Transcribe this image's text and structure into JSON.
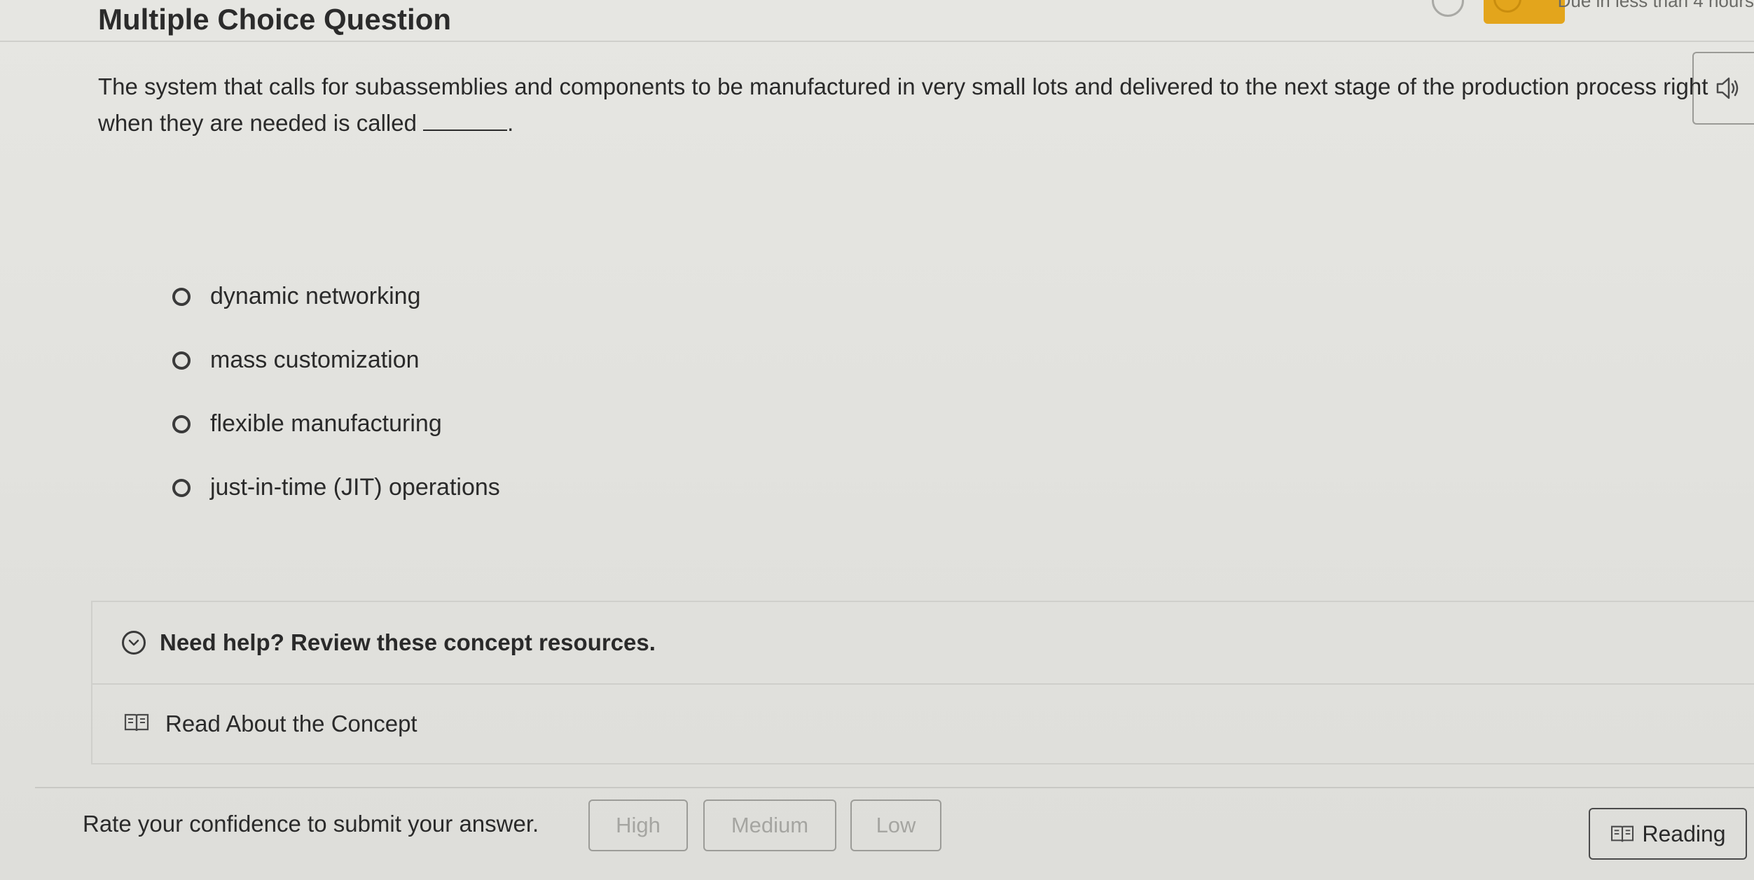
{
  "header": {
    "title": "Multiple Choice Question",
    "due_text": "Due in less than 4 hours"
  },
  "question": {
    "text_before": "The system that calls for subassemblies and components to be manufactured in very small lots and delivered to the next stage of the production process right when they are needed is called",
    "text_after": "."
  },
  "options": [
    {
      "label": "dynamic networking"
    },
    {
      "label": "mass customization"
    },
    {
      "label": "flexible manufacturing"
    },
    {
      "label": "just-in-time (JIT) operations"
    }
  ],
  "help": {
    "title": "Need help? Review these concept resources.",
    "link_label": "Read About the Concept"
  },
  "confidence": {
    "prompt": "Rate your confidence to submit your answer.",
    "high": "High",
    "medium": "Medium",
    "low": "Low"
  },
  "reading": {
    "label": "Reading"
  },
  "icons": {
    "audio": "speaker-icon",
    "expand": "chevron-down-icon",
    "book": "book-icon"
  },
  "colors": {
    "accent_badge": "#e3a51c",
    "background": "#e3e3df",
    "text": "#2a2a2a",
    "disabled_text": "#a5a5a1"
  }
}
